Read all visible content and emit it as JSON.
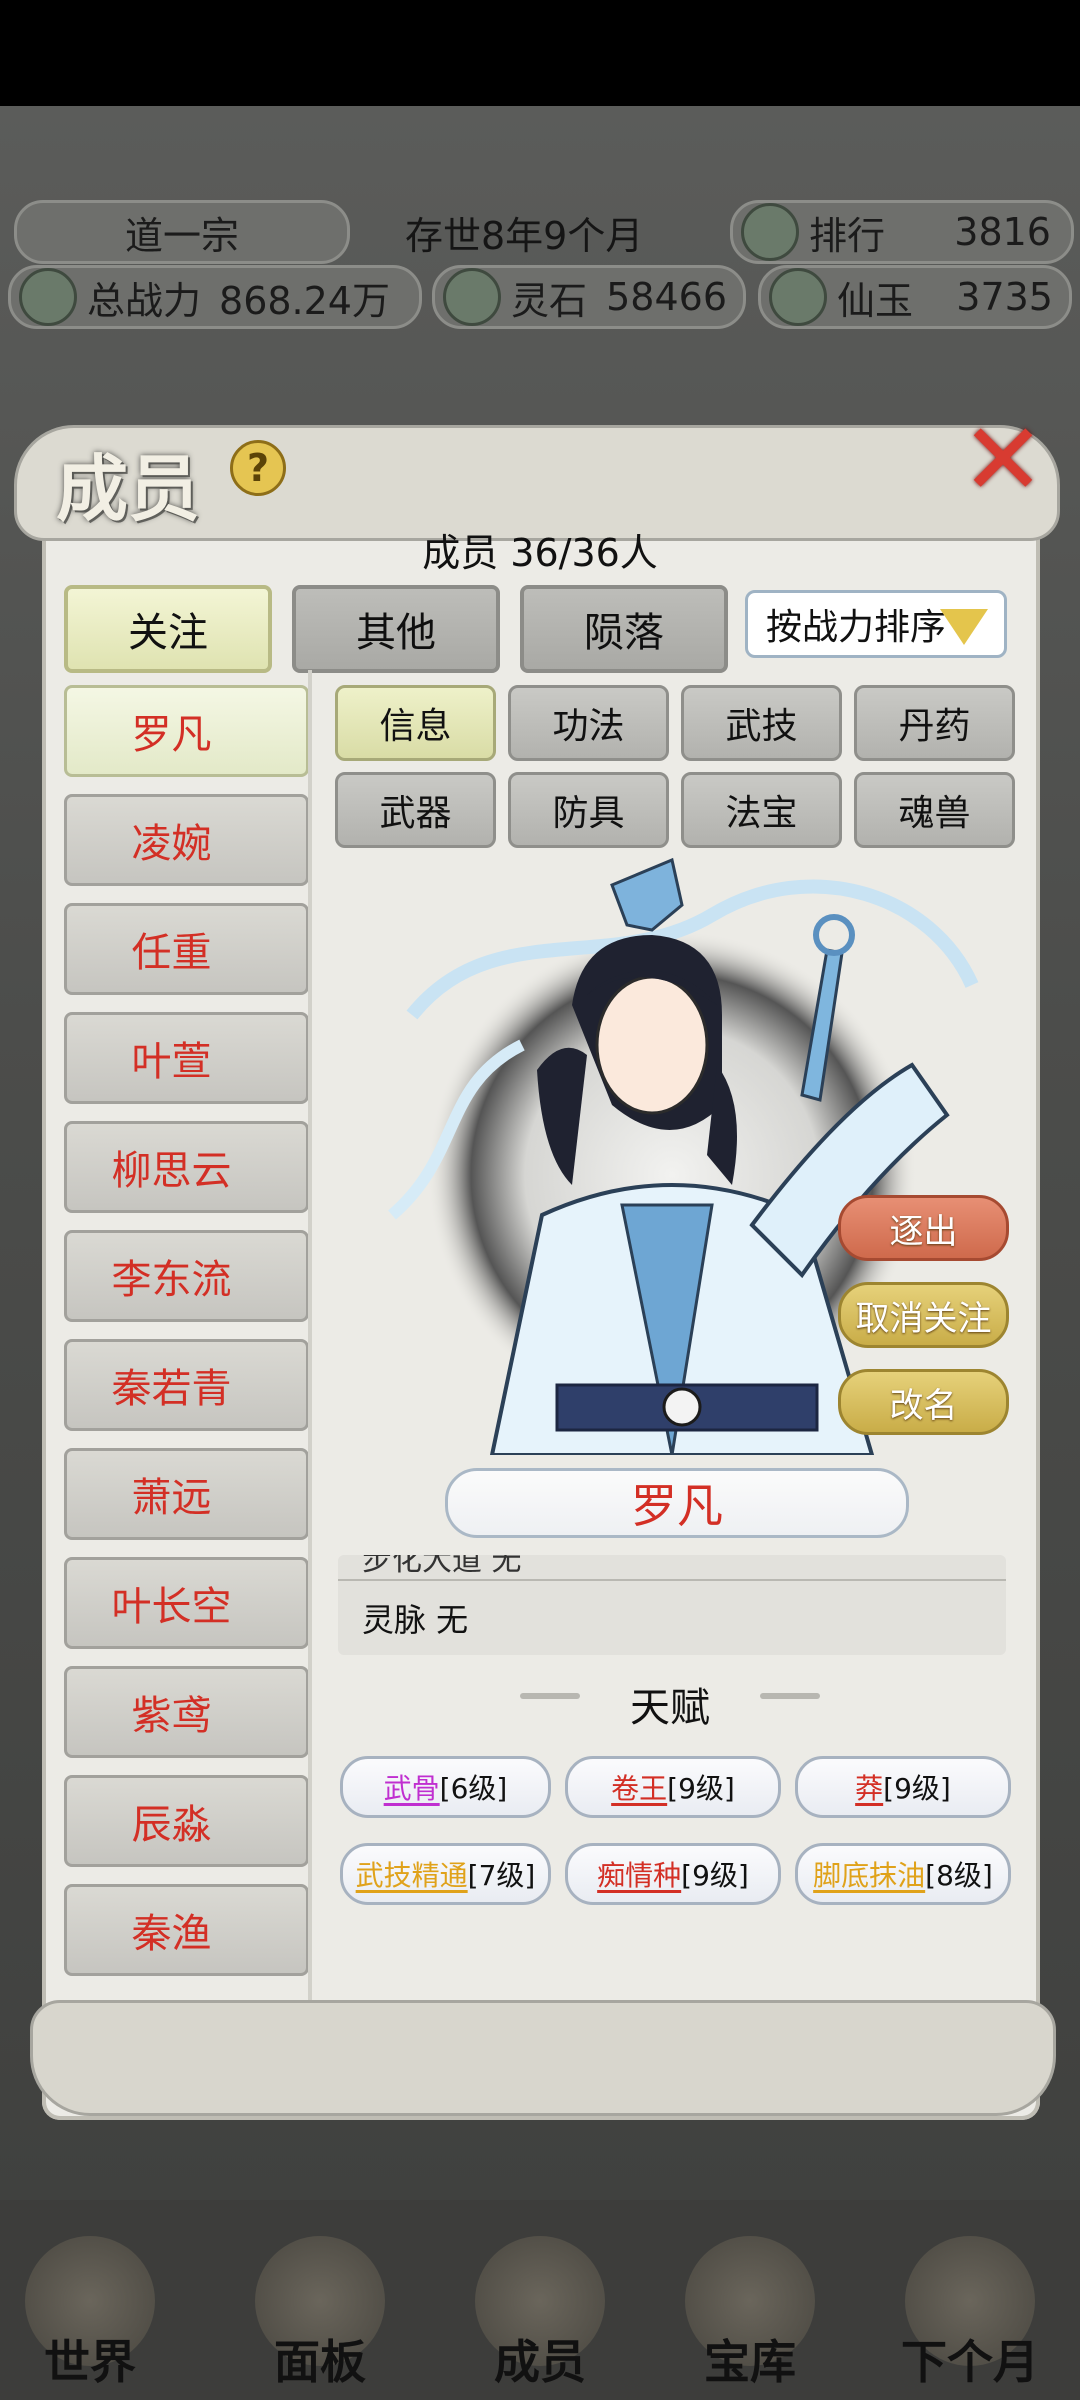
{
  "hud": {
    "sect_name": "道一宗",
    "age": "存世8年9个月",
    "rank_label": "排行",
    "rank_value": "3816",
    "power_label": "总战力",
    "power_value": "868.24万",
    "stone_label": "灵石",
    "stone_value": "58466",
    "jade_label": "仙玉",
    "jade_value": "3735"
  },
  "panel": {
    "title": "成员",
    "help": "?",
    "close": "✕",
    "member_count": "成员  36/36人",
    "tabs": [
      "关注",
      "其他",
      "陨落"
    ],
    "sort_label": "按战力排序"
  },
  "members": [
    "罗凡",
    "凌婉",
    "任重",
    "叶萱",
    "柳思云",
    "李东流",
    "秦若青",
    "萧远",
    "叶长空",
    "紫鸢",
    "辰淼",
    "秦渔"
  ],
  "subtabs": [
    "信息",
    "功法",
    "武技",
    "丹药",
    "武器",
    "防具",
    "法宝",
    "魂兽"
  ],
  "actions": {
    "expel": "逐出",
    "unfollow": "取消关注",
    "rename": "改名"
  },
  "selected": {
    "name": "罗凡",
    "info_cut": "步化大道 无",
    "spirit_vein": "灵脉  无"
  },
  "talents_title": "天赋",
  "talents": [
    {
      "name": "武骨",
      "level": "[6级]",
      "color": "#c02fd0"
    },
    {
      "name": "卷王",
      "level": "[9级]",
      "color": "#d32f25"
    },
    {
      "name": "莽",
      "level": "[9级]",
      "color": "#d32f25"
    },
    {
      "name": "武技精通",
      "level": "[7级]",
      "color": "#e0a21a"
    },
    {
      "name": "痴情种",
      "level": "[9级]",
      "color": "#d32f25"
    },
    {
      "name": "脚底抹油",
      "level": "[8级]",
      "color": "#e0a21a"
    }
  ],
  "nav": [
    "世界",
    "面板",
    "成员",
    "宝库",
    "下个月"
  ],
  "colors": {
    "accent_red": "#d32f25",
    "panel_bg": "#ecebe6"
  }
}
